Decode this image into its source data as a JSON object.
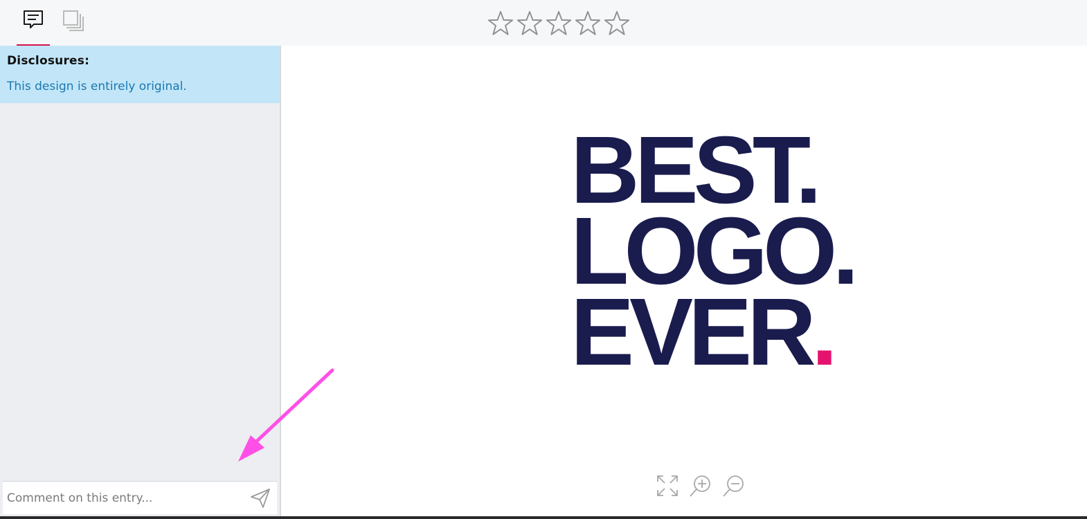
{
  "header": {
    "tabs": [
      {
        "id": "comments",
        "icon": "comment-icon",
        "active": true
      },
      {
        "id": "gallery",
        "icon": "layers-icon",
        "active": false
      }
    ],
    "rating": {
      "value": 0,
      "max": 5,
      "icon": "star-outline-icon"
    }
  },
  "sidebar": {
    "disclosure_title": "Disclosures:",
    "disclosure_text": "This design is entirely original.",
    "comment_placeholder": "Comment on this entry...",
    "send_icon": "send-icon"
  },
  "viewer": {
    "logo_lines": [
      "BEST.",
      "LOGO.",
      "EVER"
    ],
    "logo_accent": ".",
    "controls": [
      "fullscreen-icon",
      "zoom-in-icon",
      "zoom-out-icon"
    ]
  },
  "colors": {
    "tab_active": "#d6124f",
    "disclosure_bg": "#c2e6f8",
    "disclosure_text": "#1a78b0",
    "logo_text": "#1a1c4e",
    "logo_accent": "#e5136f",
    "annotation_arrow": "#ff4fe6"
  }
}
